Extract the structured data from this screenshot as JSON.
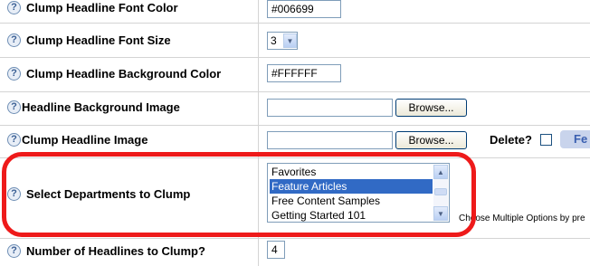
{
  "rows": [
    {
      "label": "Clump Headline Font Color",
      "value": "#006699"
    },
    {
      "label": "Clump Headline Font Size",
      "value": "3"
    },
    {
      "label": "Clump Headline Background Color",
      "value": "#FFFFFF"
    },
    {
      "label": "Headline Background Image",
      "value": "",
      "button": "Browse..."
    },
    {
      "label": "Clump Headline Image",
      "value": "",
      "button": "Browse...",
      "delete_label": "Delete?",
      "tab_text": "Fe"
    },
    {
      "label": "Select Departments to Clump",
      "hint": "Choose Multiple Options by pre"
    },
    {
      "label": "Number of Headlines to Clump?",
      "value": "4"
    }
  ],
  "departments": {
    "options": [
      "Favorites",
      "Feature Articles",
      "Free Content Samples",
      "Getting Started 101"
    ],
    "selected": "Feature Articles"
  },
  "icons": {
    "help": "?",
    "scroll_up": "▲",
    "scroll_down": "▼",
    "dropdown": "▼"
  },
  "colors": {
    "highlight": "#ee1a1a",
    "selection": "#316ac5"
  }
}
